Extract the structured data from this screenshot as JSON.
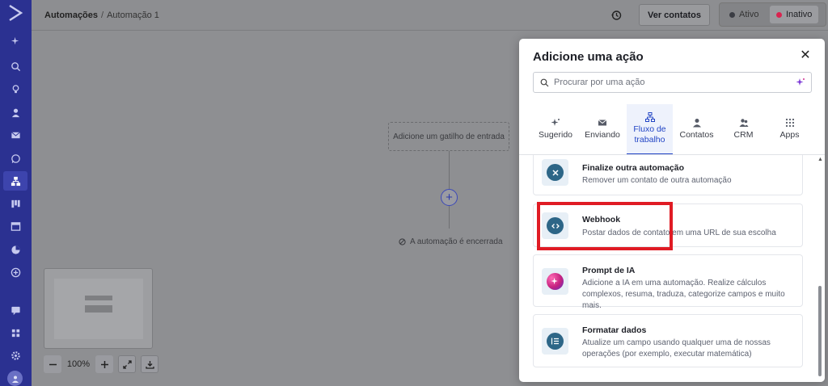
{
  "header": {
    "breadcrumb_root": "Automações",
    "breadcrumb_sep": "/",
    "breadcrumb_current": "Automação 1",
    "view_contacts_label": "Ver contatos",
    "status_active_label": "Ativo",
    "status_inactive_label": "Inativo",
    "status_active_color": "#3b3d44",
    "status_inactive_color": "#d9234f"
  },
  "canvas": {
    "trigger_placeholder": "Adicione um gatilho de entrada",
    "end_label": "A automação é encerrada",
    "zoom_level": "100%"
  },
  "modal": {
    "title": "Adicione uma ação",
    "search_placeholder": "Procurar por uma ação",
    "tabs": [
      {
        "label": "Sugerido",
        "icon": "sparkle-icon"
      },
      {
        "label": "Enviando",
        "icon": "envelope-icon"
      },
      {
        "label": "Fluxo de trabalho",
        "icon": "workflow-icon",
        "active": true
      },
      {
        "label": "Contatos",
        "icon": "person-icon"
      },
      {
        "label": "CRM",
        "icon": "people-icon"
      },
      {
        "label": "Apps",
        "icon": "apps-grid-icon"
      }
    ],
    "actions": [
      {
        "title": "Finalize outra automação",
        "desc": "Remover um contato de outra automação",
        "icon": "close-circle-icon"
      },
      {
        "title": "Webhook",
        "desc": "Postar dados de contato em uma URL de sua escolha",
        "icon": "code-icon"
      },
      {
        "title": "Prompt de IA",
        "desc": "Adicione a IA em uma automação. Realize cálculos complexos, resuma, traduza, categorize campos e muito mais.",
        "icon": "ai-sparkle-icon"
      },
      {
        "title": "Formatar dados",
        "desc": "Atualize um campo usando qualquer uma de nossas operações (por exemplo, executar matemática)",
        "icon": "format-list-icon"
      }
    ]
  },
  "colors": {
    "sidebar": "#2b3191",
    "accent": "#2245c5",
    "highlight": "#e01b24"
  }
}
